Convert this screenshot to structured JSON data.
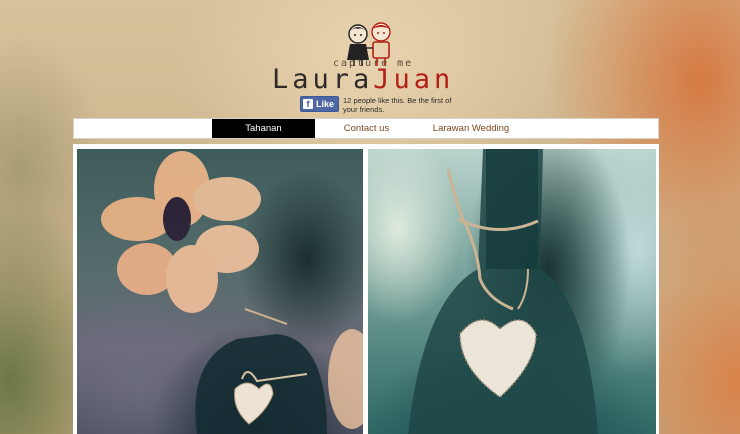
{
  "header": {
    "tagline": "capture me",
    "logo_part1": "Laura",
    "logo_part2": "Juan"
  },
  "facebook": {
    "like_label": "Like",
    "icon": "facebook-icon",
    "like_text": "12 people like this. Be the first of your friends."
  },
  "nav": {
    "items": [
      {
        "label": "Tahanan",
        "active": true
      },
      {
        "label": "Contact us",
        "active": false
      },
      {
        "label": "Larawan Wedding",
        "active": false
      }
    ]
  },
  "colors": {
    "accent_red": "#b32017",
    "nav_text": "#7a4a1e",
    "facebook_blue": "#4c67a1"
  }
}
